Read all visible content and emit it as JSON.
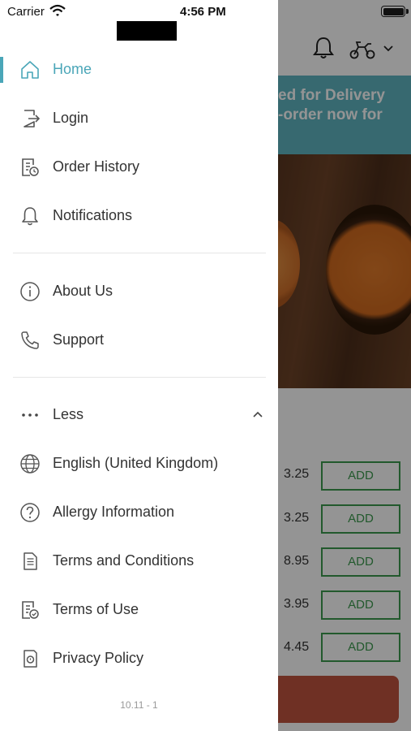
{
  "status_bar": {
    "carrier": "Carrier",
    "time": "4:56 PM"
  },
  "background": {
    "banner_line1": "ed for Delivery",
    "banner_line2": "-order now for",
    "items": [
      {
        "price": "3.25",
        "button": "ADD"
      },
      {
        "price": "3.25",
        "button": "ADD"
      },
      {
        "price": "8.95",
        "button": "ADD"
      },
      {
        "price": "3.95",
        "button": "ADD"
      },
      {
        "price": "4.45",
        "button": "ADD"
      }
    ]
  },
  "menu": {
    "primary": [
      {
        "label": "Home",
        "icon": "home-icon",
        "active": true
      },
      {
        "label": "Login",
        "icon": "login-icon"
      },
      {
        "label": "Order History",
        "icon": "order-history-icon"
      },
      {
        "label": "Notifications",
        "icon": "bell-icon"
      }
    ],
    "secondary": [
      {
        "label": "About Us",
        "icon": "info-icon"
      },
      {
        "label": "Support",
        "icon": "phone-icon"
      }
    ],
    "more": {
      "label": "Less",
      "icon": "more-dots-icon"
    },
    "tertiary": [
      {
        "label": "English (United Kingdom)",
        "icon": "globe-icon"
      },
      {
        "label": "Allergy Information",
        "icon": "question-icon"
      },
      {
        "label": "Terms and Conditions",
        "icon": "document-icon"
      },
      {
        "label": "Terms of Use",
        "icon": "document-check-icon"
      },
      {
        "label": "Privacy Policy",
        "icon": "privacy-icon"
      }
    ]
  },
  "version": "10.11 - 1",
  "colors": {
    "accent": "#4aa6b8",
    "add_green": "#3c9a4e",
    "banner": "#5fb6c2"
  }
}
